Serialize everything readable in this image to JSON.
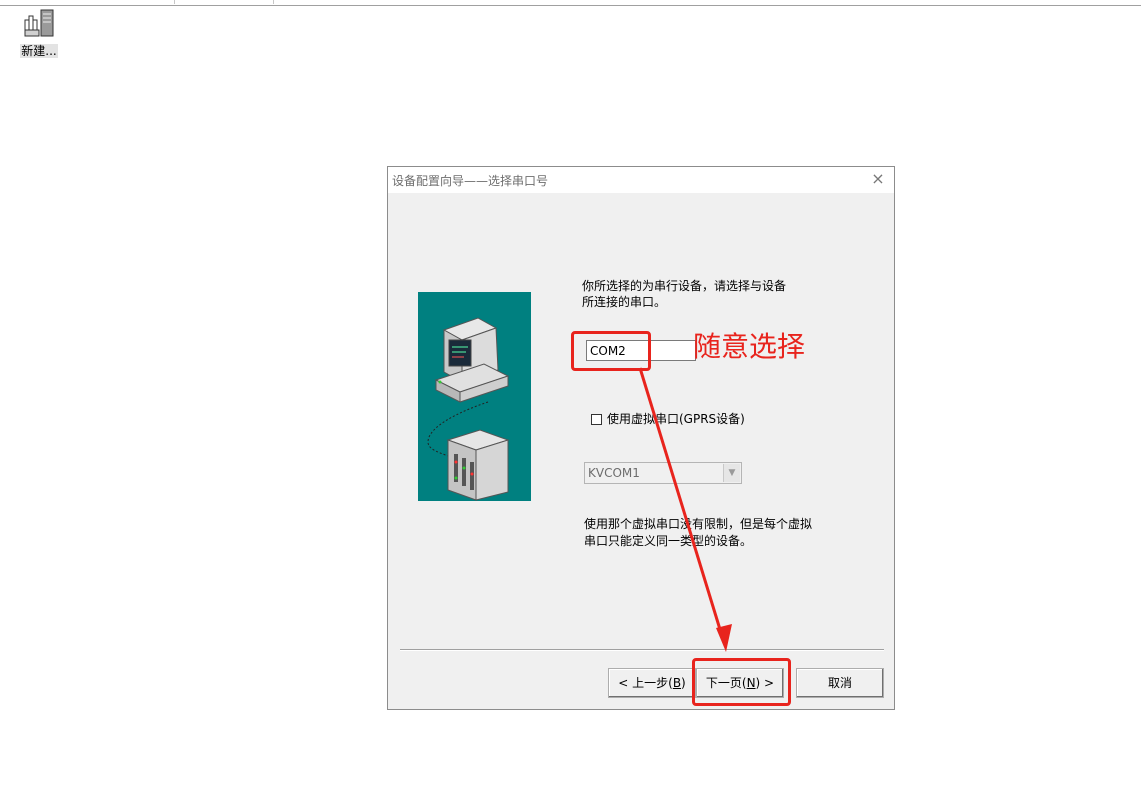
{
  "desktop": {
    "icon_label": "新建..."
  },
  "dialog": {
    "title": "设备配置向导——选择串口号",
    "close_glyph": "×",
    "instruction_line1": "你所选择的为串行设备，请选择与设备",
    "instruction_line2": "所连接的串口。",
    "port_value": "COM2",
    "virtual_checkbox_label": "使用虚拟串口(GPRS设备)",
    "virtual_checked": false,
    "virtual_port_value": "KVCOM1",
    "note_line1": "使用那个虚拟串口没有限制，但是每个虚拟",
    "note_line2": "串口只能定义同一类型的设备。",
    "buttons": {
      "back_prefix": "< 上一步(",
      "back_key": "B",
      "back_suffix": ")",
      "next_prefix": "下一页(",
      "next_key": "N",
      "next_suffix": ") >",
      "cancel": "取消"
    }
  },
  "annotation": {
    "text": "随意选择",
    "color": "#e8241d"
  },
  "colors": {
    "illustration_bg": "#008080",
    "dialog_bg": "#f0f0f0"
  }
}
